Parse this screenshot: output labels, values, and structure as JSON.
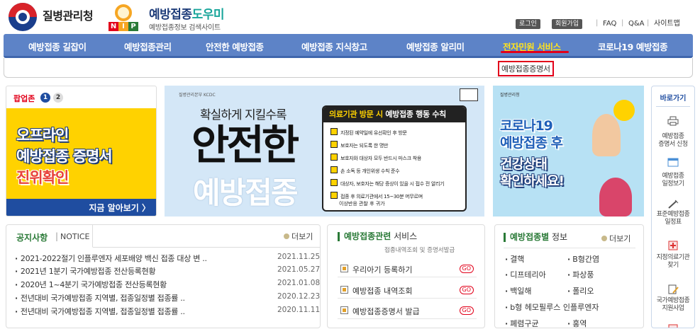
{
  "header": {
    "org_name": "질병관리청",
    "brand_main": "예방접종",
    "brand_accent": "도우미",
    "brand_sub": "예방접종정보 검색사이트",
    "nip_letters": [
      "N",
      "I",
      "P"
    ],
    "util": {
      "login": "로그인",
      "signup": "회원가입",
      "faq": "FAQ",
      "qna": "Q&A",
      "sitemap": "사이트맵",
      "separator": "|"
    }
  },
  "nav": {
    "items": [
      {
        "label": "예방접종 길잡이"
      },
      {
        "label": "예방접종관리"
      },
      {
        "label": "안전한 예방접종"
      },
      {
        "label": "예방접종 지식창고"
      },
      {
        "label": "예방접종 알리미"
      },
      {
        "label": "전자민원 서비스"
      },
      {
        "label": "코로나19 예방접종"
      }
    ],
    "sub_item": "예방접종증명서"
  },
  "popup": {
    "title": "팝업존",
    "pages": [
      "1",
      "2"
    ],
    "line1": "오프라인",
    "line2": "예방접종 증명서",
    "line3": "진위확인",
    "more": "지금 알아보기 〉"
  },
  "center_banner": {
    "logo": "질병관리본부 KCDC",
    "subtitle": "확실하게 지킬수록",
    "big1": "안전한",
    "big2": "예방접종",
    "panel_title_a": "의료기관 방문 시",
    "panel_title_b": " 예방접종 행동 수칙",
    "rules": [
      "지정된 예약일에 유선확인 후 방문",
      "보호자는 되도록 한 명만",
      "보호자와 대상자 모두 반드시 마스크 착용",
      "손 소독 등 개인위생 수칙 준수",
      "대상자, 보호자는 해당 증상이 있을 시 접수 전 알리기",
      "접종 후 의료기관에서 15~30분 머무르며",
      "이상반응 관찰 후 귀가"
    ]
  },
  "right_banner": {
    "logo": "질병관리청",
    "line1": "코로나19",
    "line2": "예방접종 후",
    "line3": "건강상태",
    "line4": "확인하세요!"
  },
  "quick": {
    "title": "바로가기",
    "items": [
      {
        "l1": "예방접종",
        "l2": "증명서 신청"
      },
      {
        "l1": "예방접종",
        "l2": "일정보기"
      },
      {
        "l1": "표준예방접종",
        "l2": "일정표"
      },
      {
        "l1": "지정의료기관",
        "l2": "찾기"
      },
      {
        "l1": "국가예방접종",
        "l2": "지원사업"
      }
    ]
  },
  "notice": {
    "tab_a": "공지사항",
    "tab_sep": "|",
    "tab_b": "NOTICE",
    "more": "더보기",
    "rows": [
      {
        "title": "2021-2022절기 인플루엔자 세포배양 백신 접종 대상 변 ..",
        "date": "2021.11.25"
      },
      {
        "title": "2021년 1분기 국가예방접종 전산등록현황",
        "date": "2021.05.27"
      },
      {
        "title": "2020년 1~4분기 국가예방접종 전산등록현황",
        "date": "2021.01.08"
      },
      {
        "title": "전년대비 국가예방접종 지역별, 접종일정별 접종률 ..",
        "date": "2020.12.23"
      },
      {
        "title": "전년대비 국가예방접종 지역별, 접종일정별 접종률 ..",
        "date": "2020.11.11"
      }
    ]
  },
  "service": {
    "head_bold": "예방접종관련",
    "head_rest": " 서비스",
    "sub": "접종내역조회 및 증명서발급",
    "rows": [
      {
        "label": "우리아기 등록하기",
        "go": "GO"
      },
      {
        "label": "예방접종 내역조회",
        "go": "GO"
      },
      {
        "label": "예방접종증명서 발급",
        "go": "GO"
      }
    ]
  },
  "vinfo": {
    "head_bold": "예방접종별",
    "head_rest": " 정보",
    "more": "더보기",
    "items": [
      "결핵",
      "B형간염",
      "디프테리아",
      "파상풍",
      "백일해",
      "폴리오",
      "b형 헤모필루스 인플루엔자",
      "폐렴구균",
      "홍역"
    ]
  },
  "colors": {
    "nav_bg": "#5d83c7",
    "nav_active": "#ffe21e",
    "red_accent": "#e2001a",
    "green_accent": "#2a7a37",
    "popup_yellow": "#ffd200",
    "navy": "#1f3d7a"
  }
}
